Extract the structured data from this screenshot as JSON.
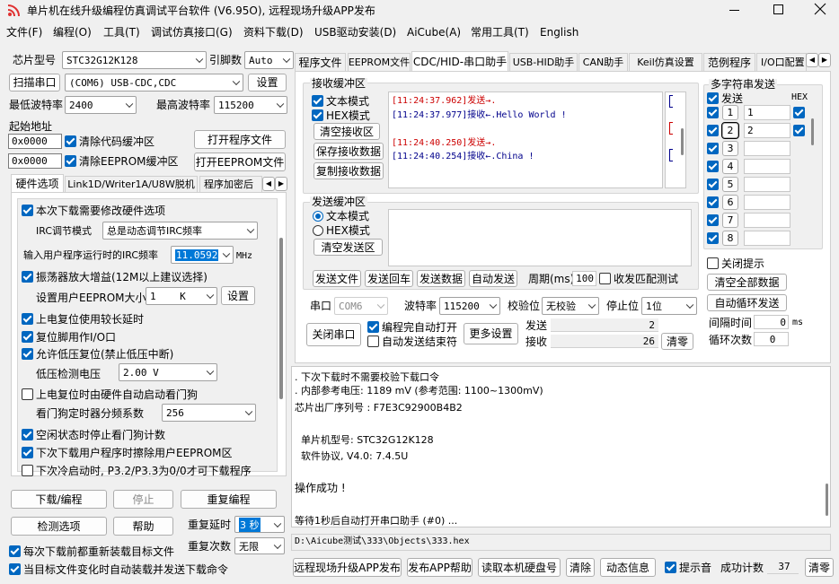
{
  "window": {
    "title": "单片机在线升级编程仿真调试平台软件 (V6.95O), 远程现场升级APP发布"
  },
  "menu": [
    "文件(F)",
    "编程(O)",
    "工具(T)",
    "调试仿真接口(G)",
    "资料下载(D)",
    "USB驱动安装(D)",
    "AiCube(A)",
    "常用工具(T)",
    "English"
  ],
  "left": {
    "chip_label": "芯片型号",
    "chip_value": "STC32G12K128",
    "pin_label": "引脚数",
    "pin_value": "Auto",
    "scan_button": "扫描串口",
    "port_value": "(COM6) USB-CDC,CDC",
    "settings_button": "设置",
    "min_baud_label": "最低波特率",
    "min_baud_value": "2400",
    "max_baud_label": "最高波特率",
    "max_baud_value": "115200",
    "start_addr_label": "起始地址",
    "addr1": "0x0000",
    "clear_code_label": "清除代码缓冲区",
    "open_prog_button": "打开程序文件",
    "addr2": "0x0000",
    "clear_eeprom_label": "清除EEPROM缓冲区",
    "open_eeprom_button": "打开EEPROM文件",
    "tabs": [
      "硬件选项",
      "Link1D/Writer1A/U8W脱机",
      "程序加密后"
    ],
    "options": {
      "o1": "本次下载需要修改硬件选项",
      "irc_mode_label": "IRC调节模式",
      "irc_mode_value": "总是动态调节IRC频率",
      "irc_freq_label": "输入用户程序运行时的IRC频率",
      "irc_freq_value": "11.0592",
      "irc_unit": "MHz",
      "o2": "振荡器放大增益(12M以上建议选择)",
      "eeprom_size_label": "设置用户EEPROM大小",
      "eeprom_size_value": "1    K",
      "eeprom_set_button": "设置",
      "o3": "上电复位使用较长延时",
      "o4": "复位脚用作I/O口",
      "o5": "允许低压复位(禁止低压中断)",
      "lv_label": "低压检测电压",
      "lv_value": "2.00 V",
      "o6": "上电复位时由硬件自动启动看门狗",
      "wdt_label": "看门狗定时器分频系数",
      "wdt_value": "256",
      "o7": "空闲状态时停止看门狗计数",
      "o8": "下次下载用户程序时擦除用户EEPROM区",
      "o9": "下次冷启动时, P3.2/P3.3为0/0才可下载程序"
    },
    "download_button": "下载/编程",
    "stop_button": "停止",
    "reprogram_button": "重复编程",
    "detect_button": "检测选项",
    "help_button": "帮助",
    "repeat_delay_label": "重复延时",
    "repeat_delay_value": "3 秒",
    "repeat_count_label": "重复次数",
    "repeat_count_value": "无限",
    "reload_label": "每次下载前都重新装载目标文件",
    "auto_send_label": "当目标文件变化时自动装载并发送下载命令"
  },
  "right_tabs": [
    "程序文件",
    "EEPROM文件",
    "CDC/HID-串口助手",
    "USB-HID助手",
    "CAN助手",
    "Keil仿真设置",
    "范例程序",
    "I/O口配置"
  ],
  "serial": {
    "recv_title": "接收缓冲区",
    "text_mode": "文本模式",
    "hex_mode": "HEX模式",
    "clear_recv": "清空接收区",
    "save_recv": "保存接收数据",
    "copy_recv": "复制接收数据",
    "log": [
      {
        "time": "[11:24:37.962]",
        "text": "发送→.",
        "kind": "send"
      },
      {
        "time": "[11:24:37.977]",
        "text": "接收←.Hello World !",
        "kind": "recv"
      },
      {
        "time": "",
        "text": "",
        "kind": "blank"
      },
      {
        "time": "[11:24:40.250]",
        "text": "发送→.",
        "kind": "send"
      },
      {
        "time": "[11:24:40.254]",
        "text": "接收←.China !",
        "kind": "recv"
      }
    ],
    "send_title": "发送缓冲区",
    "send_text_mode": "文本模式",
    "send_hex_mode": "HEX模式",
    "clear_send": "清空发送区",
    "send_file": "发送文件",
    "send_enter": "发送回车",
    "send_data": "发送数据",
    "auto_send": "自动发送",
    "period_label": "周期(ms)",
    "period_value": "100",
    "match_label": "收发匹配测试",
    "port_label": "串口",
    "port_value": "COM6",
    "baud_label": "波特率",
    "baud_value": "115200",
    "parity_label": "校验位",
    "parity_value": "无校验",
    "stop_label": "停止位",
    "stop_value": "1位",
    "close_port": "关闭串口",
    "auto_open": "编程完自动打开",
    "auto_stop": "自动发送结束符",
    "more_settings": "更多设置",
    "tx_label": "发送",
    "tx_value": "2",
    "rx_label": "接收",
    "rx_value": "26",
    "clear_count": "清零",
    "multi_title": "多字符串发送",
    "multi_send_col": "发送",
    "multi_hex_col": "HEX",
    "multi_rows": [
      {
        "n": "1",
        "v": "1"
      },
      {
        "n": "2",
        "v": "2"
      },
      {
        "n": "3",
        "v": ""
      },
      {
        "n": "4",
        "v": ""
      },
      {
        "n": "5",
        "v": ""
      },
      {
        "n": "6",
        "v": ""
      },
      {
        "n": "7",
        "v": ""
      },
      {
        "n": "8",
        "v": ""
      }
    ],
    "close_hint": "关闭提示",
    "clear_all": "清空全部数据",
    "auto_loop": "自动循环发送",
    "interval_label": "间隔时间",
    "interval_value": "0",
    "interval_unit": "ms",
    "loop_label": "循环次数",
    "loop_value": "0"
  },
  "output": {
    "lines": [
      ". 下次下载时不需要校验下载口令",
      ". 内部参考电压: 1189 mV (参考范围: 1100~1300mV)",
      "芯片出厂序列号 : F7E3C92900B4B2",
      "",
      "  单片机型号: STC32G12K128",
      "  软件协议, V4.0: 7.4.5U",
      "",
      "操作成功 !",
      "",
      "等待1秒后自动打开串口助手 (#0) ..."
    ],
    "path": "D:\\Aicube测试\\333\\Objects\\333.hex"
  },
  "bottom": {
    "remote_publish": "远程现场升级APP发布",
    "publish_help": "发布APP帮助",
    "read_disk": "读取本机硬盘号",
    "clear": "清除",
    "dynamic_info": "动态信息",
    "beep_label": "提示音",
    "success_label": "成功计数",
    "success_value": "37",
    "clear2": "清零"
  }
}
